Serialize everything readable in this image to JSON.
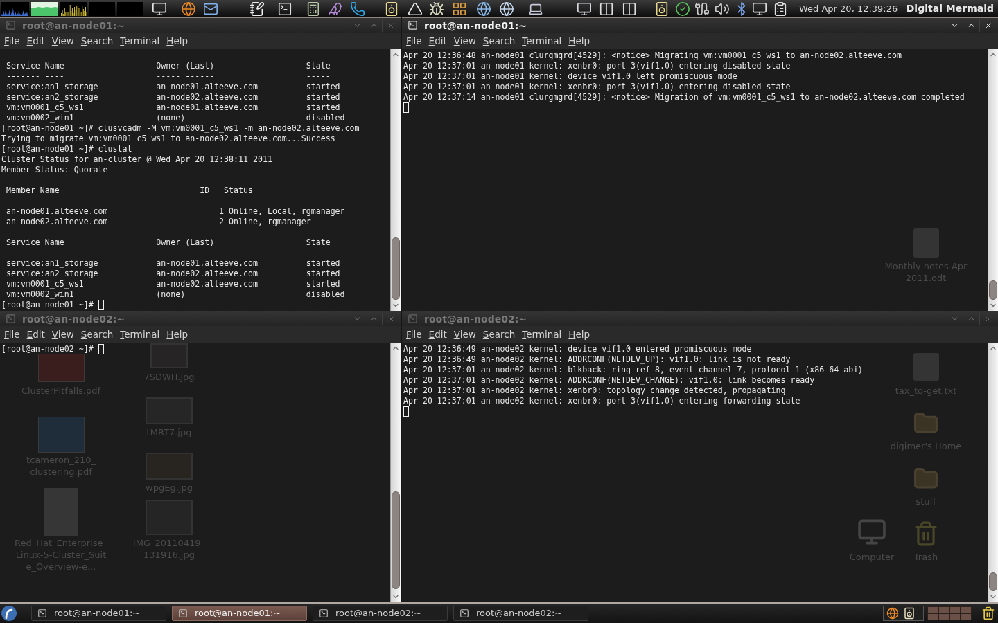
{
  "top_panel": {
    "clock": "Wed Apr 20, 12:39:26",
    "user": "Digital Mermaid"
  },
  "windows": [
    {
      "title": "root@an-node01:~",
      "focused": false,
      "menu": [
        "File",
        "Edit",
        "View",
        "Search",
        "Terminal",
        "Help"
      ],
      "cursor_on_new_line": false,
      "lines": [
        {
          "text": " Service Name                   Owner (Last)                   State",
          "gap_before": true
        },
        {
          "text": " ------- ----                   ----- ------                   -----",
          "gap_before": false
        },
        {
          "text": " service:an1_storage            an-node01.alteeve.com          started",
          "gap_before": false
        },
        {
          "text": " service:an2_storage            an-node02.alteeve.com          started",
          "gap_before": false
        },
        {
          "text": " vm:vm0001_c5_ws1               an-node01.alteeve.com          started",
          "gap_before": false
        },
        {
          "text": " vm:vm0002_win1                 (none)                         disabled",
          "gap_before": false
        },
        {
          "text": "[root@an-node01 ~]# clusvcadm -M vm:vm0001_c5_ws1 -m an-node02.alteeve.com",
          "gap_before": false
        },
        {
          "text": "Trying to migrate vm:vm0001_c5_ws1 to an-node02.alteeve.com...Success",
          "gap_before": false
        },
        {
          "text": "[root@an-node01 ~]# clustat",
          "gap_before": false
        },
        {
          "text": "Cluster Status for an-cluster @ Wed Apr 20 12:38:11 2011",
          "gap_before": false
        },
        {
          "text": "Member Status: Quorate",
          "gap_before": false
        },
        {
          "text": " Member Name                             ID   Status",
          "gap_before": true
        },
        {
          "text": " ------ ----                             ---- ------",
          "gap_before": false
        },
        {
          "text": " an-node01.alteeve.com                       1 Online, Local, rgmanager",
          "gap_before": false
        },
        {
          "text": " an-node02.alteeve.com                       2 Online, rgmanager",
          "gap_before": false
        },
        {
          "text": " Service Name                   Owner (Last)                   State",
          "gap_before": true
        },
        {
          "text": " ------- ----                   ----- ------                   -----",
          "gap_before": false
        },
        {
          "text": " service:an1_storage            an-node01.alteeve.com          started",
          "gap_before": false
        },
        {
          "text": " service:an2_storage            an-node02.alteeve.com          started",
          "gap_before": false
        },
        {
          "text": " vm:vm0001_c5_ws1               an-node02.alteeve.com          started",
          "gap_before": false
        },
        {
          "text": " vm:vm0002_win1                 (none)                         disabled",
          "gap_before": false
        },
        {
          "text": "[root@an-node01 ~]#",
          "gap_before": false
        }
      ]
    },
    {
      "title": "root@an-node01:~",
      "focused": true,
      "menu": [
        "File",
        "Edit",
        "View",
        "Search",
        "Terminal",
        "Help"
      ],
      "cursor_on_new_line": true,
      "lines": [
        {
          "text": "Apr 20 12:36:48 an-node01 clurgmgrd[4529]: <notice> Migrating vm:vm0001_c5_ws1 to an-node02.alteeve.com",
          "gap_before": false
        },
        {
          "text": "Apr 20 12:37:01 an-node01 kernel: xenbr0: port 3(vif1.0) entering disabled state",
          "gap_before": false
        },
        {
          "text": "Apr 20 12:37:01 an-node01 kernel: device vif1.0 left promiscuous mode",
          "gap_before": false
        },
        {
          "text": "Apr 20 12:37:01 an-node01 kernel: xenbr0: port 3(vif1.0) entering disabled state",
          "gap_before": false
        },
        {
          "text": "Apr 20 12:37:14 an-node01 clurgmgrd[4529]: <notice> Migration of vm:vm0001_c5_ws1 to an-node02.alteeve.com completed",
          "gap_before": false
        }
      ]
    },
    {
      "title": "root@an-node02:~",
      "focused": false,
      "menu": [
        "File",
        "Edit",
        "View",
        "Search",
        "Terminal",
        "Help"
      ],
      "cursor_on_new_line": false,
      "lines": [
        {
          "text": "[root@an-node02 ~]#",
          "gap_before": false
        }
      ]
    },
    {
      "title": "root@an-node02:~",
      "focused": false,
      "menu": [
        "File",
        "Edit",
        "View",
        "Search",
        "Terminal",
        "Help"
      ],
      "cursor_on_new_line": true,
      "lines": [
        {
          "text": "Apr 20 12:36:49 an-node02 kernel: device vif1.0 entered promiscuous mode",
          "gap_before": false
        },
        {
          "text": "Apr 20 12:36:49 an-node02 kernel: ADDRCONF(NETDEV_UP): vif1.0: link is not ready",
          "gap_before": false
        },
        {
          "text": "Apr 20 12:37:01 an-node02 kernel: blkback: ring-ref 8, event-channel 7, protocol 1 (x86_64-abi)",
          "gap_before": false
        },
        {
          "text": "Apr 20 12:37:01 an-node02 kernel: ADDRCONF(NETDEV_CHANGE): vif1.0: link becomes ready",
          "gap_before": false
        },
        {
          "text": "Apr 20 12:37:01 an-node02 kernel: xenbr0: topology change detected, propagating",
          "gap_before": false
        },
        {
          "text": "Apr 20 12:37:01 an-node02 kernel: xenbr0: port 3(vif1.0) entering forwarding state",
          "gap_before": false
        }
      ]
    }
  ],
  "desktop": {
    "icons": [
      {
        "label": "ClusterPitfalls.pdf",
        "kind": "pdf"
      },
      {
        "label": "7SDWH.jpg",
        "kind": "image"
      },
      {
        "label": "tcameron_210_clustering.pdf",
        "kind": "pdf"
      },
      {
        "label": "tMRT7.jpg",
        "kind": "image"
      },
      {
        "label": "wpgEg.jpg",
        "kind": "image"
      },
      {
        "label": "Red_Hat_Enterprise_Linux-5-Cluster_Suite_Overview-e...",
        "kind": "document"
      },
      {
        "label": "IMG_20110419_131916.jpg",
        "kind": "image"
      },
      {
        "label": "Monthly notes Apr 2011.odt",
        "kind": "file"
      },
      {
        "label": "tax_to-get.txt",
        "kind": "file"
      },
      {
        "label": "digimer's Home",
        "kind": "folder"
      },
      {
        "label": "stuff",
        "kind": "folder"
      },
      {
        "label": "Computer",
        "kind": "computer"
      },
      {
        "label": "Trash",
        "kind": "trash"
      }
    ]
  },
  "taskbar": {
    "tasks": [
      {
        "title": "root@an-node01:~",
        "selected": false
      },
      {
        "title": "root@an-node01:~",
        "selected": true
      },
      {
        "title": "root@an-node02:~",
        "selected": false
      },
      {
        "title": "root@an-node02:~",
        "selected": false
      }
    ]
  }
}
